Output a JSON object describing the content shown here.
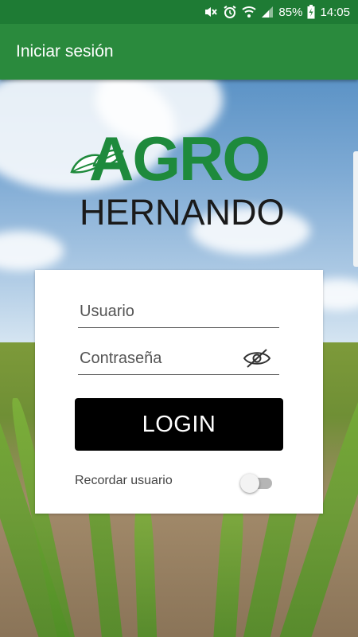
{
  "status_bar": {
    "battery": "85%",
    "time": "14:05",
    "icons": [
      "mute-icon",
      "alarm-icon",
      "wifi-icon",
      "signal-icon",
      "battery-charging-icon"
    ]
  },
  "app_bar": {
    "title": "Iniciar sesión"
  },
  "logo": {
    "line1": "AGRO",
    "line2": "HERNANDO"
  },
  "form": {
    "username_placeholder": "Usuario",
    "password_placeholder": "Contraseña",
    "login_label": "LOGIN",
    "remember_label": "Recordar usuario",
    "remember_checked": false
  },
  "colors": {
    "brand_green": "#2a8a3d",
    "status_green": "#1e7b34",
    "logo_green": "#1e8a3c",
    "button_black": "#000000"
  }
}
